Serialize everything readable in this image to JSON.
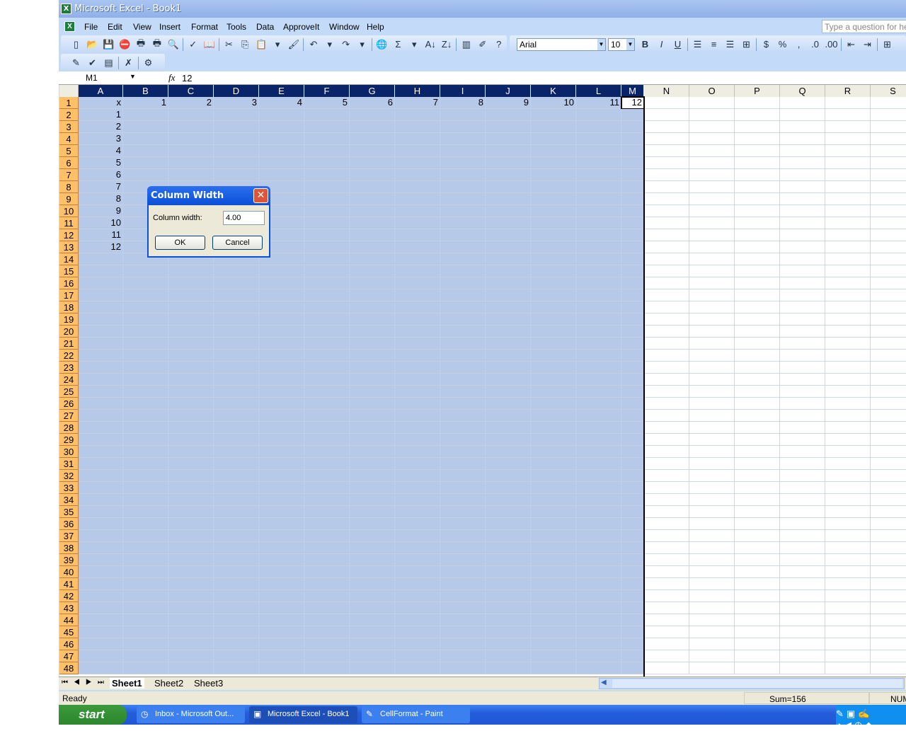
{
  "window": {
    "title": "Microsoft Excel - Book1"
  },
  "menu": {
    "items": [
      {
        "label": "File",
        "u": "F"
      },
      {
        "label": "Edit",
        "u": "E"
      },
      {
        "label": "View",
        "u": "V"
      },
      {
        "label": "Insert",
        "u": "I"
      },
      {
        "label": "Format",
        "u": "o"
      },
      {
        "label": "Tools",
        "u": "T"
      },
      {
        "label": "Data",
        "u": "D"
      },
      {
        "label": "ApproveIt",
        "u": "p"
      },
      {
        "label": "Window",
        "u": "W"
      },
      {
        "label": "Help",
        "u": "H"
      }
    ],
    "help_placeholder": "Type a question for help"
  },
  "toolbar": {
    "standard": [
      "new",
      "open",
      "save",
      "permission",
      "print-area",
      "print",
      "print-preview",
      "|",
      "spelling",
      "research",
      "|",
      "cut",
      "copy",
      "paste",
      "paste-dropdown",
      "format-painter",
      "|",
      "undo",
      "undo-dropdown",
      "redo",
      "redo-dropdown",
      "|",
      "hyperlink",
      "autosum",
      "autosum-dropdown",
      "sort-ascending",
      "sort-descending",
      "|",
      "chart-wizard",
      "drawing",
      "help"
    ],
    "font": "Arial",
    "font_size": "10",
    "formatting": [
      "bold",
      "italic",
      "underline",
      "|",
      "align-left",
      "center",
      "align-right",
      "merge-center",
      "|",
      "currency",
      "percent",
      "comma",
      "increase-decimal",
      "decrease-decimal",
      "|",
      "decrease-indent",
      "increase-indent",
      "|",
      "borders"
    ],
    "approveit": [
      "sign",
      "verify",
      "document",
      "|",
      "remove-signature",
      "|",
      "settings"
    ]
  },
  "formula_bar": {
    "name_box": "M1",
    "fx": "fx",
    "value": "12"
  },
  "sheet": {
    "columns": [
      "A",
      "B",
      "C",
      "D",
      "E",
      "F",
      "G",
      "H",
      "I",
      "J",
      "K",
      "L",
      "M",
      "N",
      "O",
      "P",
      "Q",
      "R",
      "S"
    ],
    "selected_columns": [
      "A",
      "B",
      "C",
      "D",
      "E",
      "F",
      "G",
      "H",
      "I",
      "J",
      "K",
      "L",
      "M"
    ],
    "row_count": 48,
    "active_cell": "M1",
    "cells": {
      "A1": "x",
      "B1": "1",
      "C1": "2",
      "D1": "3",
      "E1": "4",
      "F1": "5",
      "G1": "6",
      "H1": "7",
      "I1": "8",
      "J1": "9",
      "K1": "10",
      "L1": "11",
      "M1": "12",
      "A2": "1",
      "A3": "2",
      "A4": "3",
      "A5": "4",
      "A6": "5",
      "A7": "6",
      "A8": "7",
      "A9": "8",
      "A10": "9",
      "A11": "10",
      "A12": "11",
      "A13": "12"
    },
    "tabs": [
      "Sheet1",
      "Sheet2",
      "Sheet3"
    ],
    "active_tab": "Sheet1"
  },
  "dialog": {
    "title": "Column Width",
    "label": "Column width:",
    "value": "4.00",
    "ok": "OK",
    "cancel": "Cancel"
  },
  "status": {
    "left": "Ready",
    "sum": "Sum=156",
    "num": "NUM"
  },
  "taskbar": {
    "start": "start",
    "tasks": [
      {
        "label": "Inbox - Microsoft Out...",
        "icon": "outlook"
      },
      {
        "label": "Microsoft Excel - Book1",
        "icon": "excel"
      },
      {
        "label": "CellFormat - Paint",
        "icon": "paint"
      }
    ],
    "active_task": 1
  },
  "colors": {
    "selection": "#b6c9e8",
    "header_selected": "#0a246a",
    "row_header": "#ffc068",
    "title_blue": "#0b4fd8"
  }
}
